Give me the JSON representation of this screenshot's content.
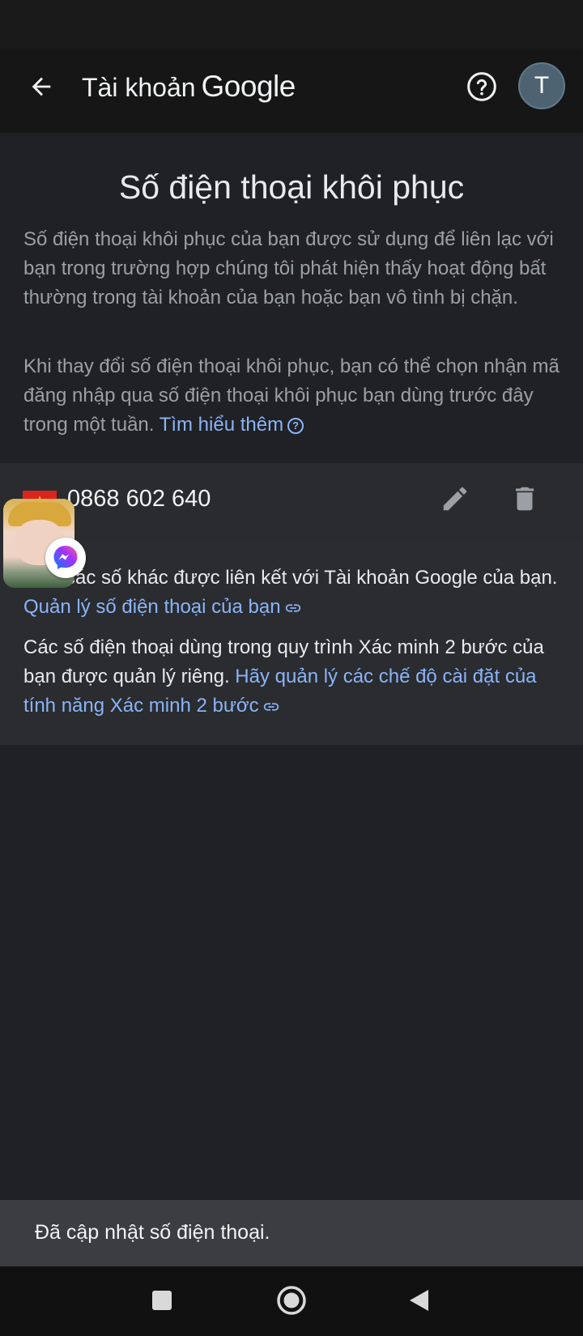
{
  "app_bar": {
    "title_prefix": "Tài khoản",
    "title_brand": "Google",
    "avatar_initial": "T",
    "icons": {
      "back": "arrow-back-icon",
      "help": "help-circle-icon"
    }
  },
  "page": {
    "title": "Số điện thoại khôi phục",
    "description_1": "Số điện thoại khôi phục của bạn được sử dụng để liên lạc với bạn trong trường hợp chúng tôi phát hiện thấy hoạt động bất thường trong tài khoản của bạn hoặc bạn vô tình bị chặn.",
    "description_2": "Khi thay đổi số điện thoại khôi phục, bạn có thể chọn nhận mã đăng nhập qua số điện thoại khôi phục bạn dùng trước đây trong một tuần.",
    "learn_more_link": "Tìm hiểu thêm"
  },
  "phone": {
    "number": "0868 602 640",
    "country_flag": "vietnam-flag-icon",
    "flag_color": "#da251d"
  },
  "info": {
    "text_1": "ể có các số khác được liên kết với Tài khoản Google của bạn.",
    "link_1": "Quản lý số điện thoại của bạn",
    "text_2": "Các số điện thoại dùng trong quy trình Xác minh 2 bước của bạn được quản lý riêng.",
    "link_2": "Hãy quản lý các chế độ cài đặt của tính năng Xác minh 2 bước"
  },
  "snackbar": {
    "message": "Đã cập nhật số điện thoại."
  },
  "colors": {
    "background": "#202124",
    "app_bar": "#161616",
    "link": "#8ab4f8",
    "secondary_text": "#9aa0a6",
    "snackbar": "#3c3d41"
  }
}
